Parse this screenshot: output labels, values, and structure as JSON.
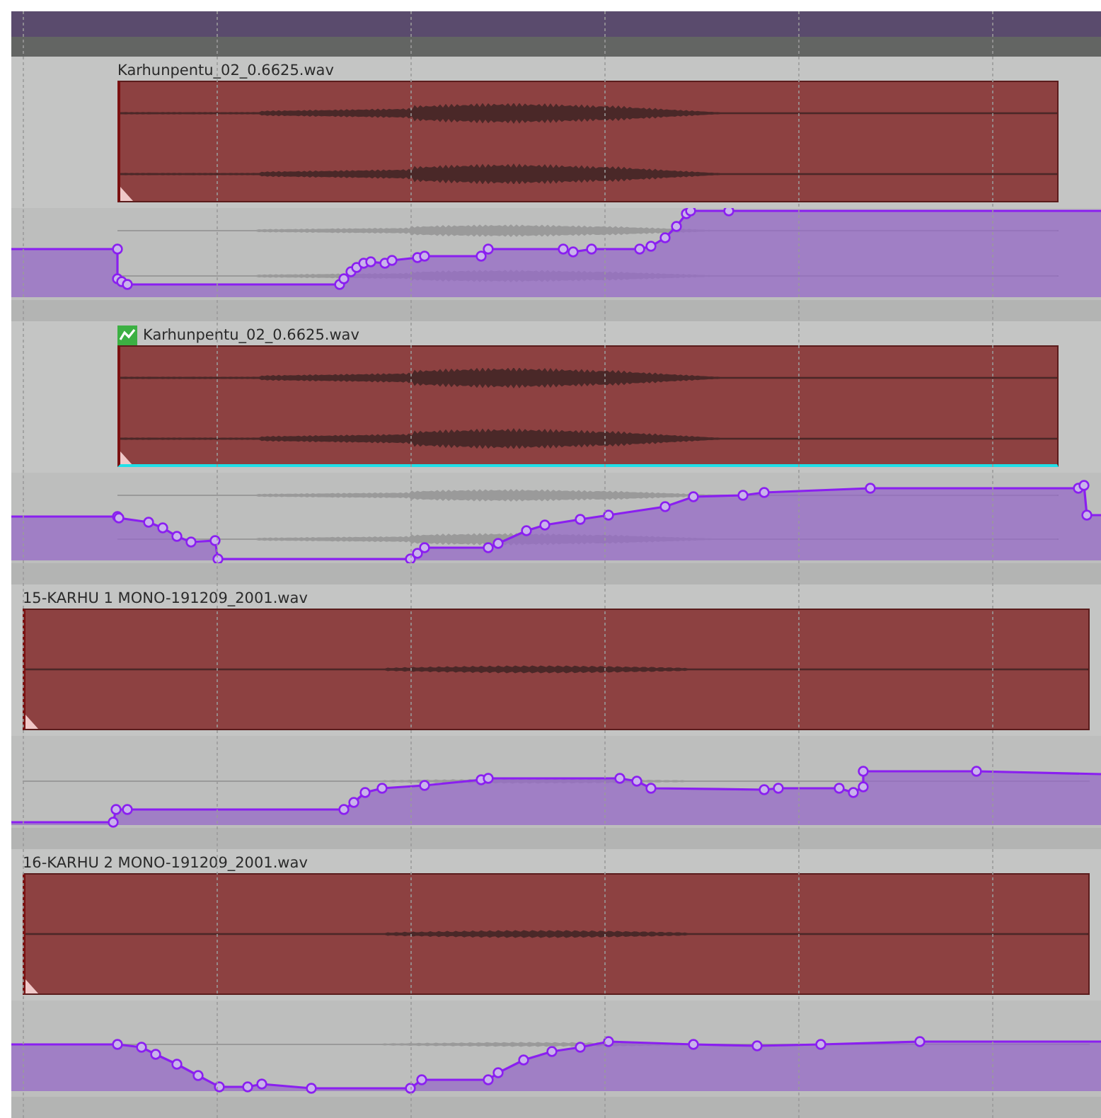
{
  "tracks": [
    {
      "item": {
        "name": "Karhunpentu_02_0.6625.wav",
        "kind": "stereo",
        "envelope_icon": false,
        "selected": false
      }
    },
    {
      "item": {
        "name": "Karhunpentu_02_0.6625.wav",
        "kind": "stereo",
        "envelope_icon": true,
        "selected": true
      }
    },
    {
      "item": {
        "name": "15-KARHU 1 MONO-191209_2001.wav",
        "kind": "mono",
        "envelope_icon": false,
        "selected": false
      }
    },
    {
      "item": {
        "name": "16-KARHU 2 MONO-191209_2001.wav",
        "kind": "mono",
        "envelope_icon": false,
        "selected": false
      }
    }
  ]
}
